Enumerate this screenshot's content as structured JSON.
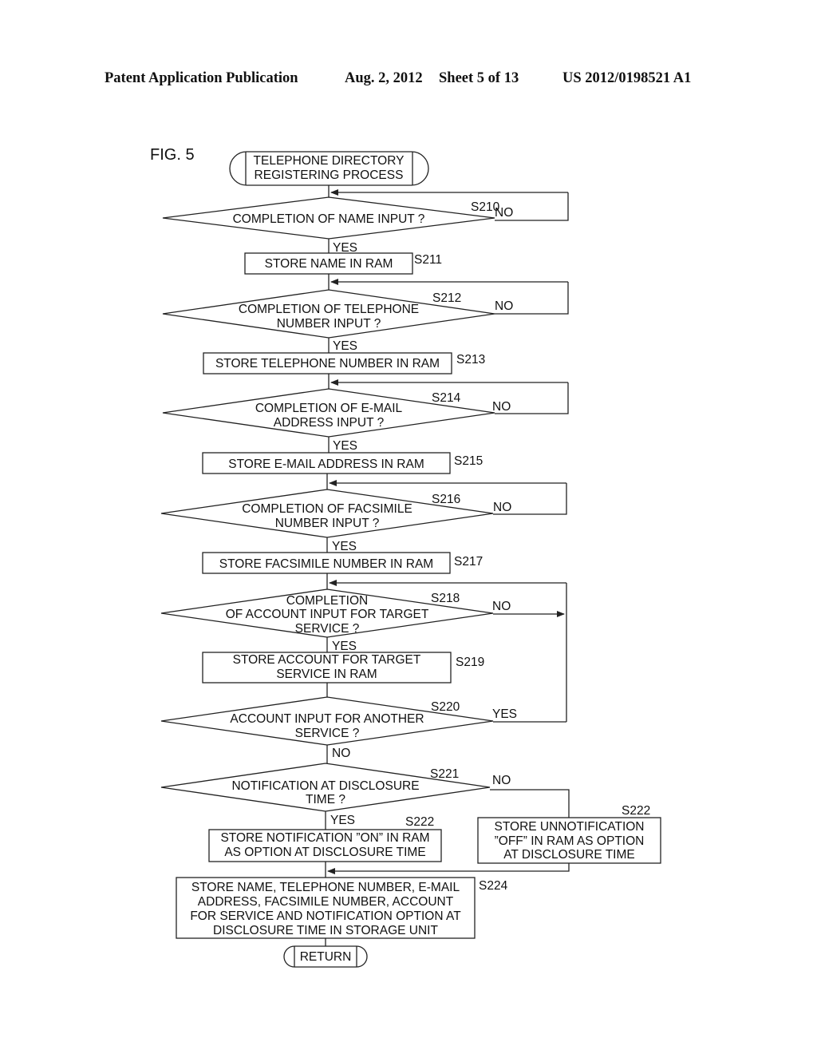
{
  "header": {
    "publication": "Patent Application Publication",
    "date": "Aug. 2, 2012",
    "sheet": "Sheet 5 of 13",
    "number": "US 2012/0198521 A1"
  },
  "figure": {
    "label": "FIG. 5",
    "start": [
      "TELEPHONE DIRECTORY",
      "REGISTERING PROCESS"
    ],
    "end": "RETURN",
    "branch_labels": {
      "yes": "YES",
      "no": "NO"
    },
    "steps": [
      {
        "id": "S210",
        "type": "decision",
        "lines": [
          "COMPLETION OF NAME INPUT ?"
        ],
        "yes": "S211",
        "no": "loop"
      },
      {
        "id": "S211",
        "type": "process",
        "lines": [
          "STORE NAME IN RAM"
        ]
      },
      {
        "id": "S212",
        "type": "decision",
        "lines": [
          "COMPLETION OF TELEPHONE",
          "NUMBER INPUT ?"
        ],
        "yes": "S213",
        "no": "loop"
      },
      {
        "id": "S213",
        "type": "process",
        "lines": [
          "STORE TELEPHONE NUMBER IN RAM"
        ]
      },
      {
        "id": "S214",
        "type": "decision",
        "lines": [
          "COMPLETION OF E-MAIL",
          "ADDRESS INPUT ?"
        ],
        "yes": "S215",
        "no": "loop"
      },
      {
        "id": "S215",
        "type": "process",
        "lines": [
          "STORE E-MAIL ADDRESS IN RAM"
        ]
      },
      {
        "id": "S216",
        "type": "decision",
        "lines": [
          "COMPLETION OF FACSIMILE",
          "NUMBER INPUT ?"
        ],
        "yes": "S217",
        "no": "loop"
      },
      {
        "id": "S217",
        "type": "process",
        "lines": [
          "STORE FACSIMILE NUMBER IN RAM"
        ]
      },
      {
        "id": "S218",
        "type": "decision",
        "lines": [
          "COMPLETION",
          "OF ACCOUNT INPUT FOR TARGET",
          "SERVICE ?"
        ],
        "yes": "S219",
        "no": "loop"
      },
      {
        "id": "S219",
        "type": "process",
        "lines": [
          "STORE ACCOUNT FOR TARGET",
          "SERVICE IN RAM"
        ]
      },
      {
        "id": "S220",
        "type": "decision",
        "lines": [
          "ACCOUNT INPUT FOR ANOTHER",
          "SERVICE ?"
        ],
        "yes": "S218",
        "no": "S221"
      },
      {
        "id": "S221",
        "type": "decision",
        "lines": [
          "NOTIFICATION AT DISCLOSURE",
          "TIME ?"
        ],
        "yes": "S222a",
        "no": "S222b"
      },
      {
        "id": "S222",
        "type": "process",
        "key": "S222a",
        "lines": [
          "STORE NOTIFICATION ”ON” IN RAM",
          "AS OPTION AT DISCLOSURE TIME"
        ]
      },
      {
        "id": "S222",
        "type": "process",
        "key": "S222b",
        "lines": [
          "STORE UNNOTIFICATION",
          "”OFF” IN RAM AS OPTION",
          "AT DISCLOSURE TIME"
        ]
      },
      {
        "id": "S224",
        "type": "process",
        "lines": [
          "STORE NAME, TELEPHONE NUMBER, E-MAIL",
          "ADDRESS, FACSIMILE NUMBER, ACCOUNT",
          "FOR SERVICE AND NOTIFICATION OPTION AT",
          "DISCLOSURE TIME IN STORAGE UNIT"
        ]
      }
    ]
  }
}
